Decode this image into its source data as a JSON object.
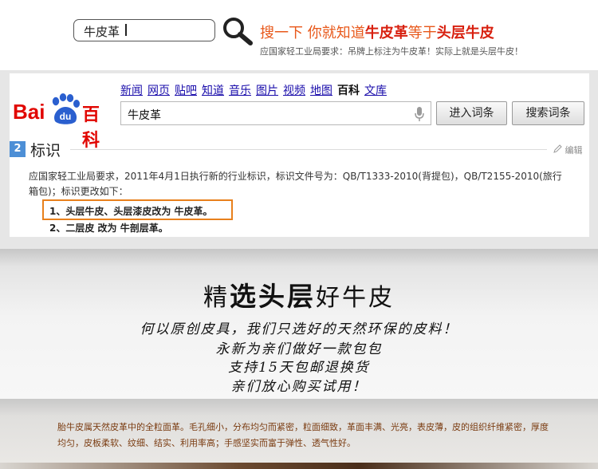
{
  "top": {
    "search_value": "牛皮革",
    "slogan_prefix": "搜一下 你就知道",
    "slogan_bold1": "牛皮革",
    "slogan_mid": "等于",
    "slogan_bold2": "头层牛皮",
    "sub": "应国家轻工业局要求：吊牌上标注为牛皮革！实际上就是头层牛皮！"
  },
  "baidu": {
    "nav": [
      "新闻",
      "网页",
      "贴吧",
      "知道",
      "音乐",
      "图片",
      "视频",
      "地图"
    ],
    "nav_active": "百科",
    "nav_last": "文库",
    "logo_bai": "Bai",
    "logo_du": "du",
    "logo_baike": "百科",
    "input_value": "牛皮革",
    "enter_button": "进入词条",
    "search_button": "搜索词条",
    "section_number": "2",
    "section_title": "标识",
    "edit_label": "编辑",
    "para_line1": "应国家轻工业局要求，2011年4月1日执行新的行业标识，标识文件号为：QB/T1333-2010(背提包)，QB/T2155-2010(旅行",
    "para_line2": "箱包)；标识更改如下：",
    "item1": "1、头层牛皮、头层漆皮改为 牛皮革。",
    "item2": "2、二层皮 改为 牛剖层革。"
  },
  "headline": {
    "pre": "精",
    "big": "选头层",
    "post": "好牛皮"
  },
  "handwriting": [
    "何以原创皮具，我们只选好的天然环保的皮料！",
    "永新为亲们做好一款包包",
    "支持15天包邮退换货",
    "亲们放心购买试用！"
  ],
  "description": "胎牛皮属天然皮革中的全粒面革。毛孔细小，分布均匀而紧密，粒面细致，革面丰满、光亮，表皮薄，皮的组织纤维紧密，厚度均匀，皮板柔软、纹细、结实、利用率高；手感坚实而富于弹性、透气性好。",
  "colors": {
    "slogan": "#e8581a",
    "slogan_bold": "#d8200f",
    "baidu_red": "#e10601",
    "baidu_blue": "#2a5fcf",
    "highlight_border": "#e8801c",
    "section_badge": "#4d8fd6"
  }
}
